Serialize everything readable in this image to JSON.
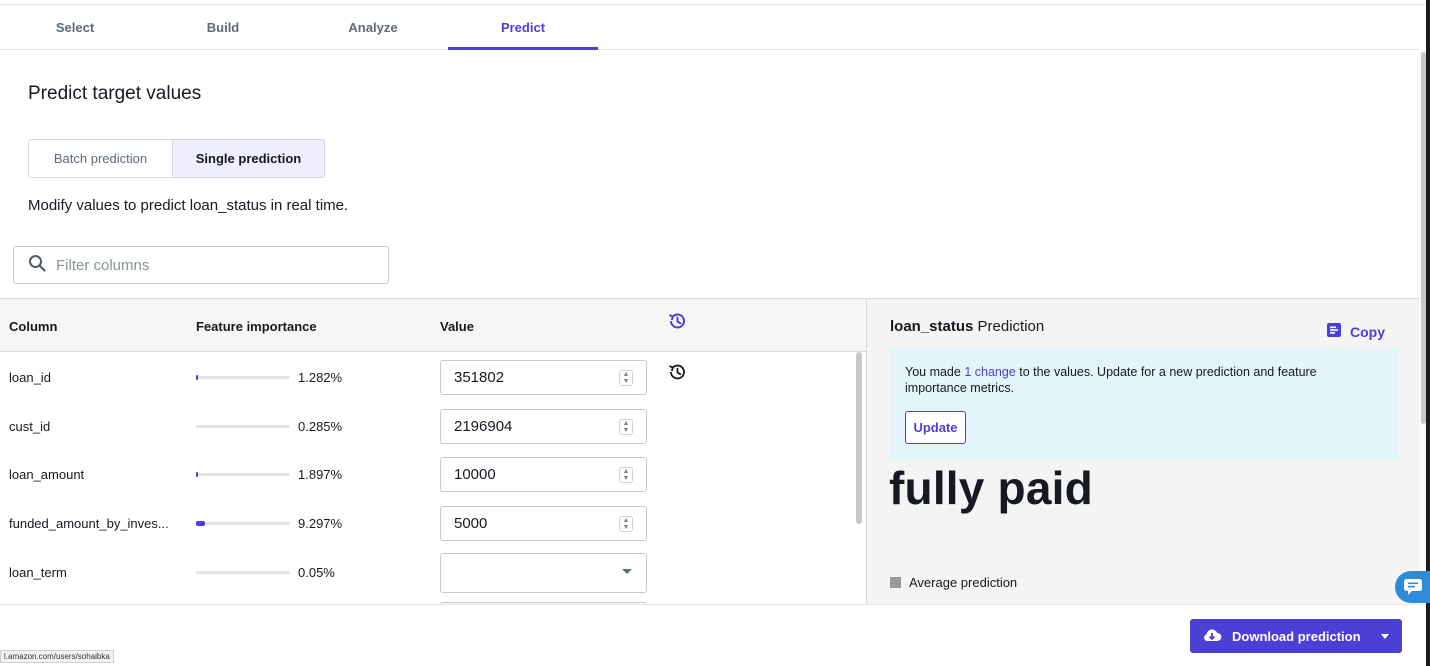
{
  "tabs": [
    {
      "label": "Select"
    },
    {
      "label": "Build"
    },
    {
      "label": "Analyze"
    },
    {
      "label": "Predict",
      "active": true
    }
  ],
  "page": {
    "title": "Predict target values",
    "description": "Modify values to predict loan_status in real time."
  },
  "mode_toggle": {
    "batch_label": "Batch prediction",
    "single_label": "Single prediction",
    "selected": "Single prediction"
  },
  "filter": {
    "placeholder": "Filter columns",
    "value": ""
  },
  "table": {
    "headers": {
      "column": "Column",
      "importance": "Feature importance",
      "value": "Value"
    },
    "rows": [
      {
        "column": "loan_id",
        "importance_label": "1.282%",
        "importance": 1.282,
        "value": "351802",
        "input_type": "number"
      },
      {
        "column": "cust_id",
        "importance_label": "0.285%",
        "importance": 0.285,
        "value": "2196904",
        "input_type": "number"
      },
      {
        "column": "loan_amount",
        "importance_label": "1.897%",
        "importance": 1.897,
        "value": "10000",
        "input_type": "number"
      },
      {
        "column": "funded_amount_by_inves...",
        "importance_label": "9.297%",
        "importance": 9.297,
        "value": "5000",
        "input_type": "number"
      },
      {
        "column": "loan_term",
        "importance_label": "0.05%",
        "importance": 0.05,
        "value": "",
        "input_type": "select"
      }
    ]
  },
  "prediction": {
    "target": "loan_status",
    "title_suffix": "Prediction",
    "copy_label": "Copy",
    "info_prefix": "You made ",
    "info_link": "1 change",
    "info_suffix": " to the values. Update for a new prediction and feature importance metrics.",
    "update_label": "Update",
    "value": "fully paid",
    "legend_label": "Average prediction"
  },
  "footer": {
    "download_label": "Download prediction",
    "status_url": "l.amazon.com/users/sohaibka"
  },
  "colors": {
    "accent": "#4c3fd6",
    "info_bg": "#e3f4fa",
    "chat": "#2e8bd8"
  },
  "icons": {
    "search": "search-icon",
    "reset": "history-reset-icon",
    "copy": "copy-icon",
    "download": "cloud-download-icon",
    "chat": "chat-icon"
  }
}
